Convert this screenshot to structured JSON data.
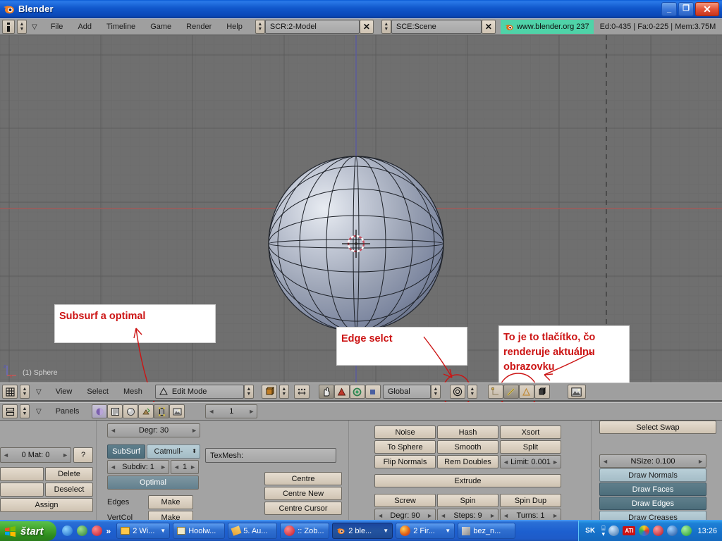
{
  "window": {
    "title": "Blender",
    "icon": "blender-logo-icon",
    "buttons": {
      "minimize": "_",
      "restore": "❐",
      "close": "✕"
    }
  },
  "top_header": {
    "window_type_icon": "info-icon",
    "collapse_icon": "chevron-down-icon",
    "menus": [
      "File",
      "Add",
      "Timeline",
      "Game",
      "Render",
      "Help"
    ],
    "screen_selector": {
      "icon": "updown-arrows-icon",
      "value": "SCR:2-Model",
      "delete_label": "✕"
    },
    "scene_selector": {
      "icon": "updown-arrows-icon",
      "value": "SCE:Scene",
      "delete_label": "✕"
    },
    "version_badge": {
      "icon": "blender-logo-icon",
      "text": "www.blender.org 237",
      "color": "#4fd3a8"
    },
    "stats": "Ed:0-435 | Fa:0-225 | Mem:3.75M"
  },
  "viewport": {
    "object_info": "(1) Sphere",
    "axis_gizmo": {
      "z": "z",
      "x": "x"
    },
    "cursor": "3d-cursor-icon",
    "background": "#6f6f6f",
    "grid_color": "#5f5f5f",
    "x_axis_color": "#9c5a5a",
    "y_axis_color": "#5a5a9c"
  },
  "annotations": [
    {
      "id": "note-subsurf",
      "text": "Subsurf a optimal"
    },
    {
      "id": "note-edge-select",
      "text": "Edge selct"
    },
    {
      "id": "note-render",
      "text": "To je to tlačítko, čo renderuje aktuálnu obrazovku"
    }
  ],
  "view3d_header": {
    "window_type_icon": "grid-3d-icon",
    "collapse_icon": "chevron-down-icon",
    "menus": [
      "View",
      "Select",
      "Mesh"
    ],
    "mode_selector": {
      "icon": "edit-mode-icon",
      "value": "Edit Mode",
      "arrows": "updown-arrows-icon"
    },
    "draw_type_icon": "shading-solid-icon",
    "snap_icon": "magnet-icon",
    "widget_icons": [
      "proportional-edit-icon",
      "dots-icon"
    ],
    "manipulator_icons": [
      "hand-translate-icon",
      "rotate-manipulator-icon",
      "scale-manipulator-icon",
      "square-manipulator-icon"
    ],
    "transform_orientation": "Global",
    "layers_icon": "layers-icon",
    "select_modes": [
      "vertex-select-icon",
      "edge-select-icon",
      "face-select-icon",
      "occlude-geometry-icon"
    ],
    "active_select_mode": "edge-select-icon",
    "render_button_icon": "render-image-icon"
  },
  "buttons_header": {
    "window_type_icon": "buttons-window-icon",
    "collapse_icon": "chevron-down-icon",
    "label": "Panels",
    "context_icons": [
      "shading-icon",
      "object-icon",
      "material-icon",
      "editing-icon",
      "scene-icon",
      "scripts-icon"
    ],
    "active_context_icon": "editing-icon",
    "frame_field": {
      "value": "1",
      "left_arrow": "◄",
      "right_arrow": "►"
    }
  },
  "panels": {
    "link_materials": {
      "mat_button": {
        "label": "0 Mat: 0",
        "left_arrow": "◄",
        "right_arrow": "►"
      },
      "help_button": "?",
      "buttons": [
        "Delete",
        "Deselect",
        "Assign"
      ]
    },
    "mesh": {
      "degr_button": {
        "label": "Degr: 30",
        "left_arrow": "◄",
        "right_arrow": "►"
      },
      "subsurf_toggle": {
        "label": "SubSurf",
        "active": true
      },
      "subsurf_type": {
        "value": "Catmull-",
        "arrows": "updown-arrows-icon"
      },
      "subdiv": {
        "label": "Subdiv: 1",
        "left_arrow": "◄",
        "right_arrow": "►"
      },
      "render_levels": {
        "label": "1",
        "left_arrow": "◄",
        "right_arrow": "►"
      },
      "optimal": {
        "label": "Optimal",
        "active": true
      },
      "edges_label": "Edges",
      "edges_make": "Make",
      "vertcol_label": "VertCol",
      "vertcol_make": "Make"
    },
    "mesh_texmesh": {
      "texmesh_field": {
        "label": "TexMesh:",
        "value": ""
      },
      "centre_buttons": [
        "Centre",
        "Centre New",
        "Centre Cursor"
      ]
    },
    "mesh_tools": {
      "row1": [
        "Noise",
        "Hash",
        "Xsort"
      ],
      "row2": [
        "To Sphere",
        "Smooth",
        "Split"
      ],
      "row3": [
        "Flip Normals",
        "Rem Doubles"
      ],
      "limit": {
        "label": "Limit: 0.001",
        "left_arrow": "◄",
        "right_arrow": "►"
      },
      "extrude": "Extrude",
      "row4": [
        "Screw",
        "Spin",
        "Spin Dup"
      ],
      "row5": [
        {
          "label": "Degr: 90",
          "left_arrow": "◄",
          "right_arrow": "►"
        },
        {
          "label": "Steps: 9",
          "left_arrow": "◄",
          "right_arrow": "►"
        },
        {
          "label": "Turns: 1",
          "left_arrow": "◄",
          "right_arrow": "►"
        }
      ]
    },
    "mesh_tools_more": {
      "select_swap": "Select Swap",
      "nsize": {
        "label": "NSize: 0.100",
        "left_arrow": "◄",
        "right_arrow": "►"
      },
      "toggles": [
        {
          "label": "Draw Normals",
          "active": false
        },
        {
          "label": "Draw Faces",
          "active": true
        },
        {
          "label": "Draw Edges",
          "active": true
        },
        {
          "label": "Draw Creases",
          "active": false
        }
      ]
    }
  },
  "taskbar": {
    "start_label": "štart",
    "quicklaunch": [
      "media-player-icon",
      "browser-icon",
      "opera-icon",
      "more-chevrons-icon"
    ],
    "tasks": [
      {
        "label": "2 Wi...",
        "icon": "folder-icon",
        "has_dropdown": true,
        "active": false
      },
      {
        "label": "Hoolw...",
        "icon": "document-icon",
        "has_dropdown": false,
        "active": false
      },
      {
        "label": "5. Au...",
        "icon": "pencil-icon",
        "has_dropdown": false,
        "active": false
      },
      {
        "label": ":: Zob...",
        "icon": "opera-icon",
        "has_dropdown": false,
        "active": false
      },
      {
        "label": "2 ble...",
        "icon": "blender-logo-icon",
        "has_dropdown": true,
        "active": true
      },
      {
        "label": "2 Fir...",
        "icon": "firefox-icon",
        "has_dropdown": true,
        "active": false
      },
      {
        "label": "bez_n...",
        "icon": "paint-icon",
        "has_dropdown": false,
        "active": false
      }
    ],
    "language": "SK",
    "tray_icons": [
      "show-desktop-icon",
      "ati-icon",
      "colors-icon",
      "opera-icon",
      "antivirus-icon",
      "clover-icon"
    ],
    "clock": "13:26"
  }
}
